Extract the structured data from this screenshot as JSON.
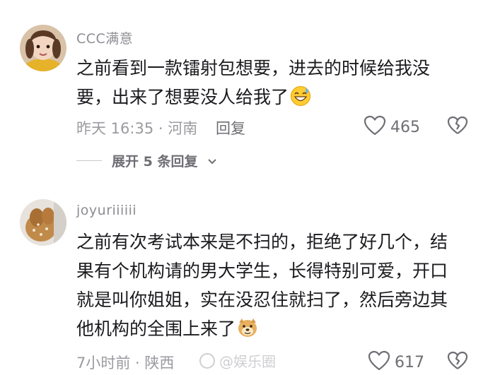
{
  "comments": [
    {
      "username": "CCC满意",
      "text_line1": "之前看到一款镭射包想要，进去的时候给我没",
      "text_line2": "要，出来了想要没人给我了",
      "emoji": "sweat-smile-emoji",
      "meta": "昨天 16:35 · 河南",
      "reply_label": "回复",
      "likes": "465",
      "expand_label": "展开 5 条回复"
    },
    {
      "username": "joyuriiiiii",
      "text_line1": "之前有次考试本来是不扫的，拒绝了好几个，结",
      "text_line2": "果有个机构请的男大学生，长得特别可爱，开口",
      "text_line3": "就是叫你姐姐，实在没忍住就扫了，然后旁边其",
      "text_line4": "他机构的全围上来了",
      "emoji": "doge-emoji",
      "meta": "7小时前 · 陕西",
      "likes": "617",
      "watermark": "@娱乐圈"
    }
  ],
  "icons": {
    "like": "heart-outline-icon",
    "dislike": "broken-heart-icon",
    "expand": "chevron-down-icon"
  },
  "colors": {
    "text": "#1b1b1f",
    "meta": "#9a9aa0",
    "username": "#8d8d93"
  }
}
